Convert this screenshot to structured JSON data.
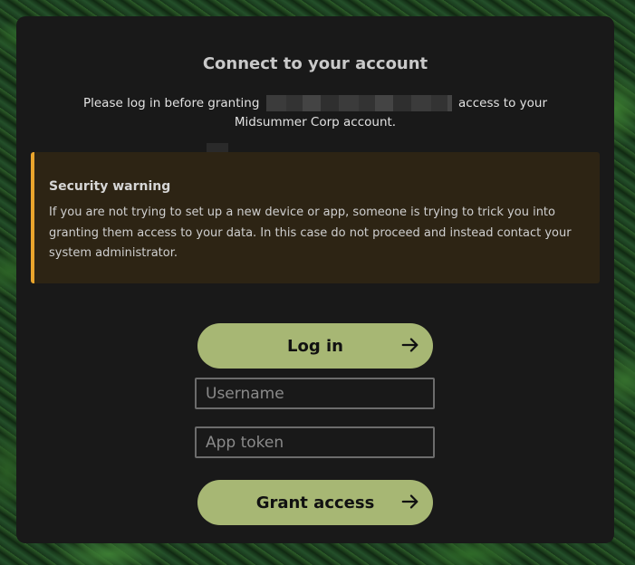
{
  "page": {
    "title": "Connect to your account",
    "intro_before": "Please log in before granting",
    "intro_after": "access to your Midsummer Corp account."
  },
  "warning": {
    "title": "Security warning",
    "body": "If you are not trying to set up a new device or app, someone is trying to trick you into granting them access to your data. In this case do not proceed and instead contact your system administrator.",
    "accent_color": "#e9a42c"
  },
  "login": {
    "button_label": "Log in",
    "icon": "arrow-right-icon"
  },
  "form": {
    "username_placeholder": "Username",
    "token_placeholder": "App token",
    "grant_label": "Grant access",
    "icon": "arrow-right-icon"
  },
  "theme": {
    "button_color": "#a7b774",
    "card_color": "#191919"
  }
}
